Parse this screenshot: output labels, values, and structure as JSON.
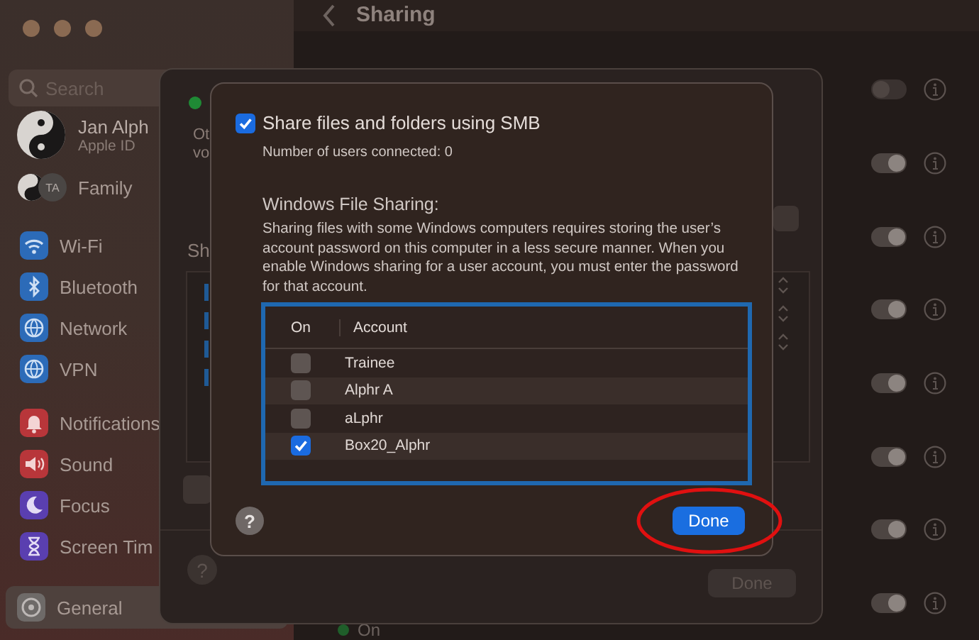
{
  "sidebar": {
    "search": {
      "placeholder": "Search"
    },
    "account": {
      "name": "Jan Alph",
      "subtitle": "Apple ID"
    },
    "family": {
      "badge": "TA",
      "label": "Family"
    },
    "groups": [
      [
        {
          "label": "Wi-Fi",
          "kind": "wifi",
          "color": "#2c6bb8",
          "selected": false
        },
        {
          "label": "Bluetooth",
          "kind": "bluetooth",
          "color": "#2c6bb8",
          "selected": false
        },
        {
          "label": "Network",
          "kind": "globe",
          "color": "#2c6bb8",
          "selected": false
        },
        {
          "label": "VPN",
          "kind": "globe",
          "color": "#2c6bb8",
          "selected": false
        }
      ],
      [
        {
          "label": "Notifications",
          "kind": "bell",
          "color": "#b8363a",
          "selected": false
        },
        {
          "label": "Sound",
          "kind": "speaker",
          "color": "#b8363a",
          "selected": false
        },
        {
          "label": "Focus",
          "kind": "moon",
          "color": "#5a3fb0",
          "selected": false
        },
        {
          "label": "Screen Tim",
          "kind": "hourglass",
          "color": "#5a3fb0",
          "selected": false
        }
      ],
      [
        {
          "label": "General",
          "kind": "gear",
          "color": "#6e6a68",
          "selected": true
        }
      ]
    ]
  },
  "header": {
    "title": "Sharing"
  },
  "services": [
    {
      "on": false
    },
    {
      "on": true
    },
    {
      "on": true
    },
    {
      "on": true
    },
    {
      "on": true
    },
    {
      "on": true
    },
    {
      "on": true
    },
    {
      "on": true
    }
  ],
  "status_line": {
    "label": "On"
  },
  "back_sheet": {
    "status_fragment": "Ot",
    "description_fragment": "vo",
    "section_fragment": "Sh",
    "help": "?",
    "done": "Done"
  },
  "smb_sheet": {
    "share": {
      "label": "Share files and folders using SMB",
      "checked": true
    },
    "users_connected": "Number of users connected: 0",
    "heading": "Windows File Sharing:",
    "note": "Sharing files with some Windows computers requires storing the user’s account password on this computer in a less secure manner. When you enable Windows sharing for a user account, you must enter the password for that account.",
    "table": {
      "columns": [
        "On",
        "Account"
      ],
      "rows": [
        {
          "account": "Trainee",
          "checked": false
        },
        {
          "account": "Alphr A",
          "checked": false
        },
        {
          "account": "aLphr",
          "checked": false
        },
        {
          "account": "Box20_Alphr",
          "checked": true
        }
      ]
    },
    "help": "?",
    "done": "Done"
  }
}
